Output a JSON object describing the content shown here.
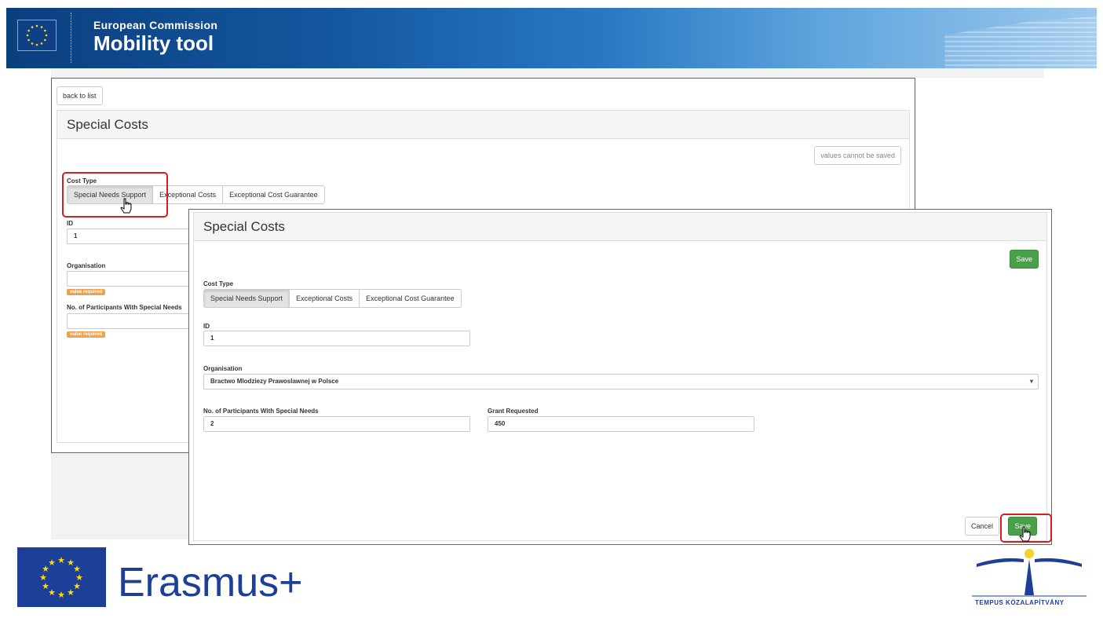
{
  "header": {
    "org_name": "European Commission",
    "app_name": "Mobility tool"
  },
  "back_panel": {
    "back_button": "back to list",
    "title": "Special Costs",
    "status_button": "values cannot be saved",
    "cost_type_label": "Cost Type",
    "cost_types": [
      "Special Needs Support",
      "Exceptional Costs",
      "Exceptional Cost Guarantee"
    ],
    "active_cost_type": "Special Needs Support",
    "id_label": "ID",
    "id_value": "1",
    "organisation_label": "Organisation",
    "organisation_value": "",
    "required_badge": "value required",
    "participants_label": "No. of Participants With Special Needs",
    "participants_value": "",
    "participants_badge": "value required"
  },
  "front_panel": {
    "title": "Special Costs",
    "save_top": "Save",
    "cost_type_label": "Cost Type",
    "cost_types": [
      "Special Needs Support",
      "Exceptional Costs",
      "Exceptional Cost Guarantee"
    ],
    "active_cost_type": "Special Needs Support",
    "id_label": "ID",
    "id_value": "1",
    "organisation_label": "Organisation",
    "organisation_value": "Bractwo Mlodziezy Prawoslawnej w Polsce",
    "participants_label": "No. of Participants With Special Needs",
    "participants_value": "2",
    "grant_label": "Grant Requested",
    "grant_value": "450",
    "cancel_button": "Cancel",
    "save_bottom": "Save"
  },
  "footer": {
    "erasmus_text": "Erasmus+",
    "tempus_text": "TEMPUS KÖZALAPÍTVÁNY"
  },
  "colors": {
    "banner_blue": "#1357a0",
    "save_green": "#4aa04a",
    "highlight_red": "#d21f1f",
    "badge_orange": "#f0a24a",
    "eu_blue": "#1d3f98",
    "eu_yellow": "#ffdd00"
  },
  "icons": {
    "eu_flag": "eu-flag-icon",
    "pointer": "hand-pointer-icon",
    "dropdown": "chevron-down-icon"
  }
}
